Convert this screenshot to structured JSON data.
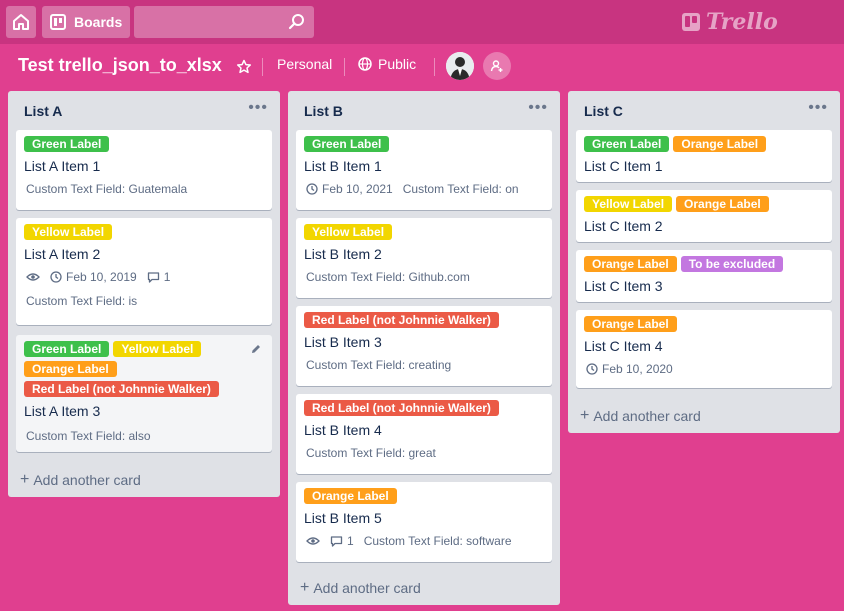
{
  "topbar": {
    "boards_label": "Boards",
    "search_placeholder": "",
    "logo_text": "Trello"
  },
  "board": {
    "title": "Test trello_json_to_xlsx",
    "team": "Personal",
    "visibility": "Public"
  },
  "colors": {
    "green": "#3ec04b",
    "yellow": "#f2d600",
    "orange": "#ff9f1a",
    "red": "#eb5a46",
    "purple": "#c377e0"
  },
  "lists": [
    {
      "title": "List A",
      "add_card": "Add another card",
      "cards": [
        {
          "labels": [
            {
              "text": "Green Label",
              "color": "#3ec04b"
            }
          ],
          "title": "List A Item 1",
          "custom": "Custom Text Field: Guatemala"
        },
        {
          "labels": [
            {
              "text": "Yellow Label",
              "color": "#f2d600"
            }
          ],
          "title": "List A Item 2",
          "date": "Feb 10, 2019",
          "comments": "1",
          "custom": "Custom Text Field: is"
        },
        {
          "labels": [
            {
              "text": "Green Label",
              "color": "#3ec04b"
            },
            {
              "text": "Yellow Label",
              "color": "#f2d600"
            },
            {
              "text": "Orange Label",
              "color": "#ff9f1a"
            },
            {
              "text": "Red Label (not Johnnie Walker)",
              "color": "#eb5a46"
            }
          ],
          "title": "List A Item 3",
          "custom": "Custom Text Field: also"
        }
      ]
    },
    {
      "title": "List B",
      "add_card": "Add another card",
      "cards": [
        {
          "labels": [
            {
              "text": "Green Label",
              "color": "#3ec04b"
            }
          ],
          "title": "List B Item 1",
          "date": "Feb 10, 2021",
          "custom": "Custom Text Field: on"
        },
        {
          "labels": [
            {
              "text": "Yellow Label",
              "color": "#f2d600"
            }
          ],
          "title": "List B Item 2",
          "custom": "Custom Text Field: Github.com"
        },
        {
          "labels": [
            {
              "text": "Red Label (not Johnnie Walker)",
              "color": "#eb5a46"
            }
          ],
          "title": "List B Item 3",
          "custom": "Custom Text Field: creating"
        },
        {
          "labels": [
            {
              "text": "Red Label (not Johnnie Walker)",
              "color": "#eb5a46"
            }
          ],
          "title": "List B Item 4",
          "custom": "Custom Text Field: great"
        },
        {
          "labels": [
            {
              "text": "Orange Label",
              "color": "#ff9f1a"
            }
          ],
          "title": "List B Item 5",
          "comments": "1",
          "custom": "Custom Text Field: software"
        }
      ]
    },
    {
      "title": "List C",
      "add_card": "Add another card",
      "cards": [
        {
          "labels": [
            {
              "text": "Green Label",
              "color": "#3ec04b"
            },
            {
              "text": "Orange Label",
              "color": "#ff9f1a"
            }
          ],
          "title": "List C Item 1"
        },
        {
          "labels": [
            {
              "text": "Yellow Label",
              "color": "#f2d600"
            },
            {
              "text": "Orange Label",
              "color": "#ff9f1a"
            }
          ],
          "title": "List C Item 2"
        },
        {
          "labels": [
            {
              "text": "Orange Label",
              "color": "#ff9f1a"
            },
            {
              "text": "To be excluded",
              "color": "#c377e0"
            }
          ],
          "title": "List C Item 3"
        },
        {
          "labels": [
            {
              "text": "Orange Label",
              "color": "#ff9f1a"
            }
          ],
          "title": "List C Item 4",
          "date": "Feb 10, 2020"
        }
      ]
    }
  ]
}
